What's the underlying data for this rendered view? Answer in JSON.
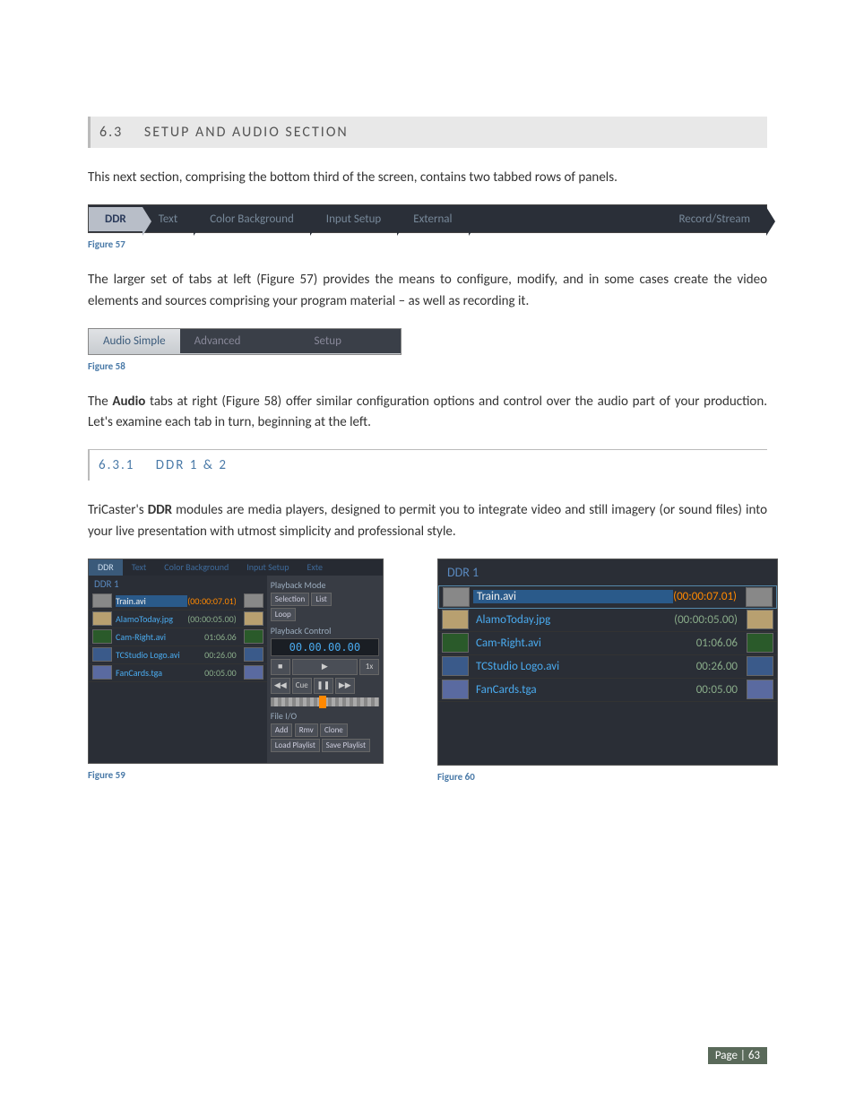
{
  "section": {
    "num": "6.3",
    "title": "SETUP AND AUDIO SECTION"
  },
  "para1": "This next section, comprising the bottom third of the screen, contains two tabbed rows of panels.",
  "fig57": {
    "tabs": [
      "DDR",
      "Text",
      "Color Background",
      "Input Setup",
      "External",
      "Record/Stream"
    ],
    "caption": "Figure 57"
  },
  "para2": "The larger set of tabs at left (Figure 57) provides the means to configure, modify, and in some cases create the video elements and sources comprising your program material – as well as recording it.",
  "fig58": {
    "tabs": [
      "Audio Simple",
      "Advanced",
      "Setup"
    ],
    "caption": "Figure 58"
  },
  "para3_a": "The ",
  "para3_bold": "Audio",
  "para3_b": " tabs at right (Figure 58) offer similar configuration options and control over the audio part of your production.  Let's examine each tab in turn, beginning at the left.",
  "subsection": {
    "num": "6.3.1",
    "title": "DDR 1 & 2"
  },
  "para4_a": "TriCaster's ",
  "para4_bold": "DDR",
  "para4_b": " modules are media players, designed to permit you to integrate video and still imagery (or sound files) into your live presentation with utmost simplicity and professional style.",
  "fig59": {
    "caption": "Figure 59",
    "panel_tabs": [
      "DDR",
      "Text",
      "Color Background",
      "Input Setup",
      "Exte"
    ],
    "ddr_label": "DDR 1",
    "playlist": [
      {
        "name": "Train.avi",
        "time": "(00:00:07.01)",
        "sel": true
      },
      {
        "name": "AlamoToday.jpg",
        "time": "(00:00:05.00)",
        "sel": false
      },
      {
        "name": "Cam-Right.avi",
        "time": "01:06.06",
        "sel": false
      },
      {
        "name": "TCStudio Logo.avi",
        "time": "00:26.00",
        "sel": false
      },
      {
        "name": "FanCards.tga",
        "time": "00:05.00",
        "sel": false
      }
    ],
    "playback_mode_label": "Playback Mode",
    "mode_selection": "Selection",
    "mode_list": "List",
    "mode_loop": "Loop",
    "playback_control_label": "Playback Control",
    "timecode": "00.00.00.00",
    "speed": "1x",
    "cue": "Cue",
    "file_io_label": "File I/O",
    "file_io_buttons": [
      "Add",
      "Rmv",
      "Clone"
    ],
    "playlist_buttons": [
      "Load Playlist",
      "Save Playlist"
    ]
  },
  "fig60": {
    "caption": "Figure 60",
    "ddr_label": "DDR 1",
    "playlist": [
      {
        "name": "Train.avi",
        "time": "(00:00:07.01)",
        "sel": true
      },
      {
        "name": "AlamoToday.jpg",
        "time": "(00:00:05.00)",
        "sel": false
      },
      {
        "name": "Cam-Right.avi",
        "time": "01:06.06",
        "sel": false
      },
      {
        "name": "TCStudio Logo.avi",
        "time": "00:26.00",
        "sel": false
      },
      {
        "name": "FanCards.tga",
        "time": "00:05.00",
        "sel": false
      }
    ]
  },
  "footer": "Page | 63"
}
